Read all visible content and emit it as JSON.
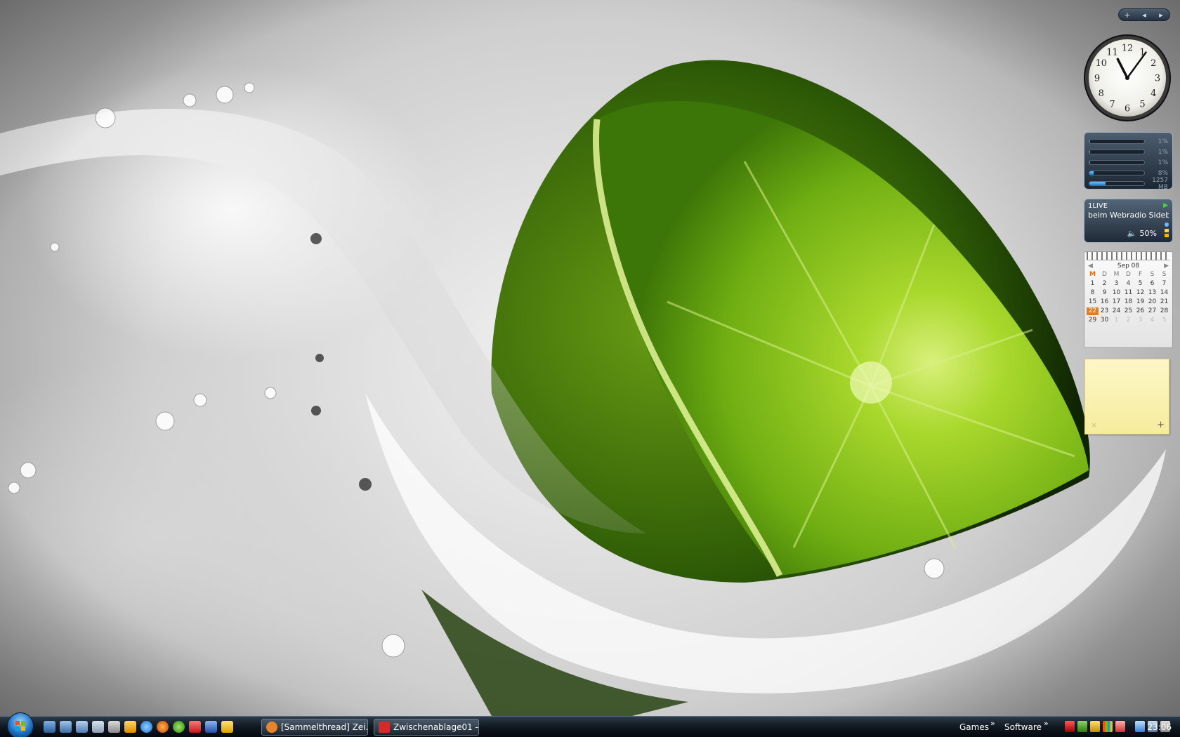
{
  "sidebar": {
    "controls": {
      "add": "+",
      "prev": "◂",
      "next": "▸"
    },
    "clock": {
      "numerals": [
        "12",
        "1",
        "2",
        "3",
        "4",
        "5",
        "6",
        "7",
        "8",
        "9",
        "10",
        "11"
      ],
      "hour": 11,
      "minute": 6
    },
    "cpu_meter": {
      "rows": [
        {
          "label": "1%",
          "fill": 1
        },
        {
          "label": "1%",
          "fill": 1
        },
        {
          "label": "1%",
          "fill": 1
        },
        {
          "label": "8%",
          "fill": 8
        },
        {
          "label": "1257 MB",
          "fill": 30
        }
      ]
    },
    "radio": {
      "station": "1LIVE",
      "text": "beim Webradio Sideb",
      "volume": "50%"
    },
    "calendar": {
      "month": "Sep 08",
      "weekdays": [
        "M",
        "D",
        "M",
        "D",
        "F",
        "S",
        "S"
      ],
      "days": [
        "1",
        "2",
        "3",
        "4",
        "5",
        "6",
        "7",
        "8",
        "9",
        "10",
        "11",
        "12",
        "13",
        "14",
        "15",
        "16",
        "17",
        "18",
        "19",
        "20",
        "21",
        "22",
        "23",
        "24",
        "25",
        "26",
        "27",
        "28",
        "29",
        "30"
      ],
      "next_days": [
        "1",
        "2",
        "3",
        "4",
        "5"
      ],
      "today": "22"
    },
    "note": {
      "close": "×",
      "add": "+"
    }
  },
  "taskbar": {
    "tasks": [
      {
        "label": "[Sammelthread] Zei...",
        "icon_color": "#e5842a"
      },
      {
        "label": "Zwischenablage01 - ...",
        "icon_color": "#d32a2a"
      }
    ],
    "toolbars": [
      {
        "label": "Games",
        "chevron": "»"
      },
      {
        "label": "Software",
        "chevron": "»"
      }
    ],
    "time": "23:06"
  },
  "colors": {
    "lime": "#8cc21a",
    "lime_dark": "#3d6b08",
    "taskbar": "#101820"
  }
}
